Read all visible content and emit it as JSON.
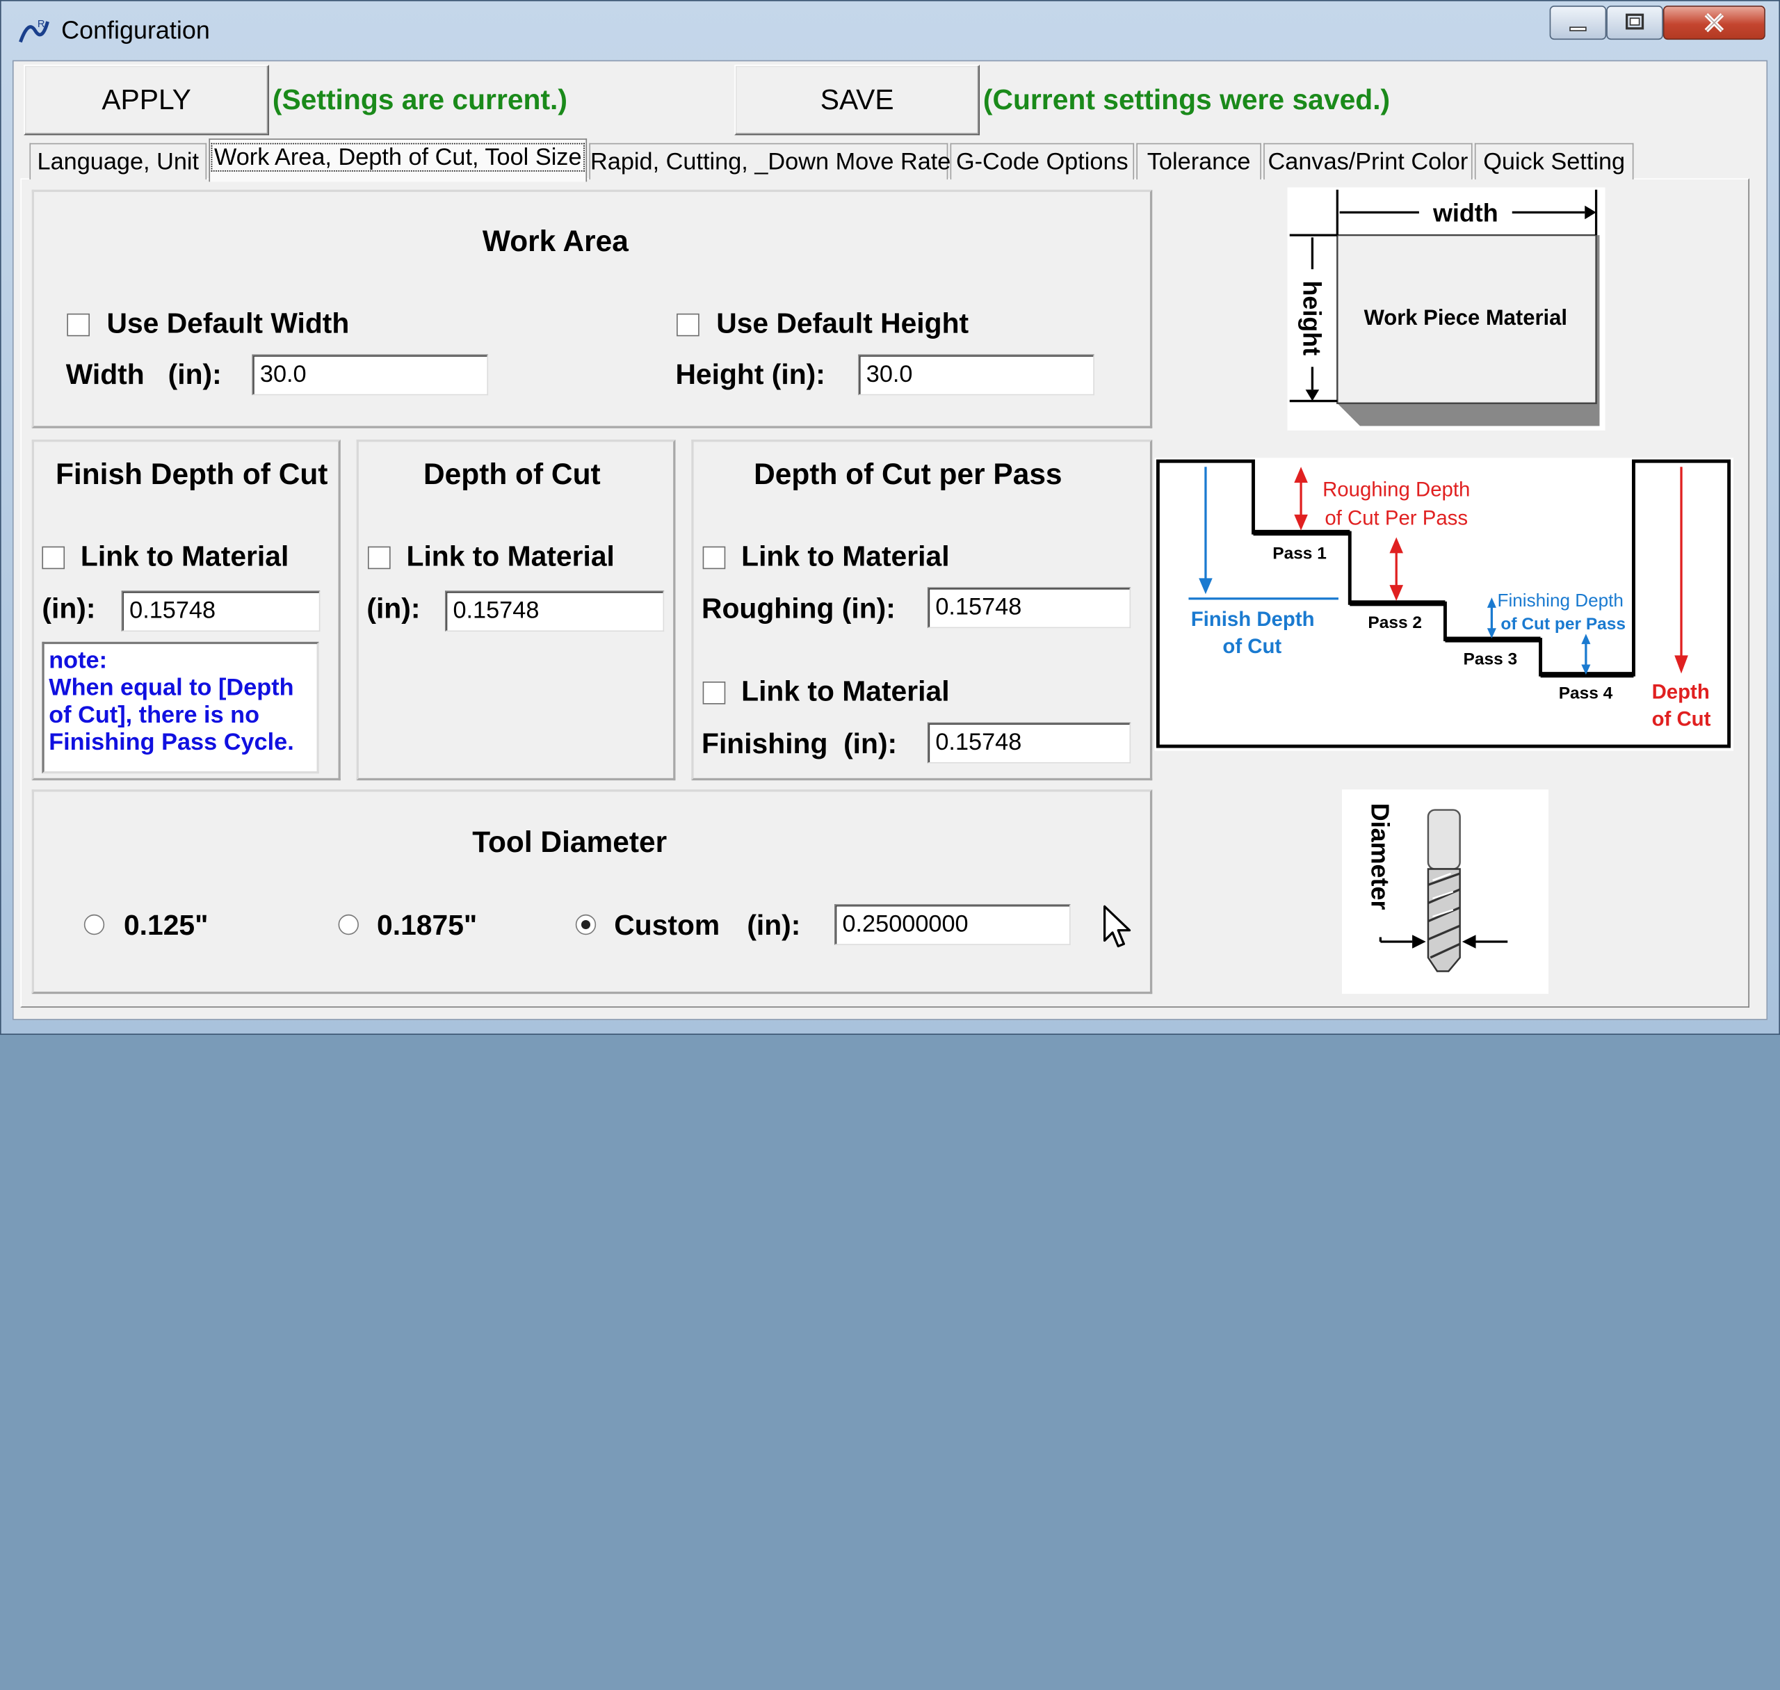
{
  "window": {
    "title": "Configuration"
  },
  "toolbar": {
    "apply_label": "APPLY",
    "apply_status": "(Settings are current.)",
    "save_label": "SAVE",
    "save_status": "(Current settings were saved.)"
  },
  "tabs": [
    {
      "label": "Language, Unit",
      "active": false
    },
    {
      "label": "Work Area, Depth of Cut, Tool Size",
      "active": true
    },
    {
      "label": "Rapid, Cutting, _Down Move Rate",
      "active": false
    },
    {
      "label": "G-Code Options",
      "active": false
    },
    {
      "label": "Tolerance",
      "active": false
    },
    {
      "label": "Canvas/Print Color",
      "active": false
    },
    {
      "label": "Quick Setting",
      "active": false
    }
  ],
  "work_area": {
    "title": "Work Area",
    "use_default_width": {
      "label": "Use Default Width",
      "checked": false
    },
    "use_default_height": {
      "label": "Use Default Height",
      "checked": false
    },
    "width_label": "Width   (in):",
    "width_value": "30.0",
    "height_label": "Height (in):",
    "height_value": "30.0"
  },
  "finish_depth": {
    "title": "Finish Depth of Cut",
    "link_label": "Link to Material",
    "link_checked": false,
    "unit_label": "(in):",
    "value": "0.15748",
    "note_lines": [
      "note:",
      "When equal to [Depth",
      "of Cut], there is no",
      "Finishing Pass Cycle."
    ]
  },
  "depth_of_cut": {
    "title": "Depth of Cut",
    "link_label": "Link to Material",
    "link_checked": false,
    "unit_label": "(in):",
    "value": "0.15748"
  },
  "depth_per_pass": {
    "title": "Depth of Cut per Pass",
    "roughing_link_label": "Link to Material",
    "roughing_link_checked": false,
    "roughing_label": "Roughing (in):",
    "roughing_value": "0.15748",
    "finishing_link_label": "Link to Material",
    "finishing_link_checked": false,
    "finishing_label": "Finishing  (in):",
    "finishing_value": "0.15748"
  },
  "tool_diameter": {
    "title": "Tool Diameter",
    "options": [
      "0.125\"",
      "0.1875\"",
      "Custom"
    ],
    "selected": "Custom",
    "custom_unit_label": "(in):",
    "custom_value": "0.25000000"
  },
  "diagram_workpiece": {
    "width_label": "width",
    "height_label": "height",
    "material_label": "Work Piece Material"
  },
  "diagram_passes": {
    "roughing_label_line1": "Roughing Depth",
    "roughing_label_line2": "of Cut Per Pass",
    "finishing_label_line1": "Finishing Depth",
    "finishing_label_line2": "of Cut per Pass",
    "finish_depth_line1": "Finish Depth",
    "finish_depth_line2": "of Cut",
    "depth_line1": "Depth",
    "depth_line2": "of Cut",
    "passes": [
      "Pass 1",
      "Pass 2",
      "Pass 3",
      "Pass 4"
    ]
  },
  "diagram_tool": {
    "diameter_label": "Diameter"
  },
  "colors": {
    "status_green": "#1a8a1a",
    "note_blue": "#1010e0",
    "diagram_red": "#e02020",
    "diagram_blue": "#1a7ad0"
  }
}
